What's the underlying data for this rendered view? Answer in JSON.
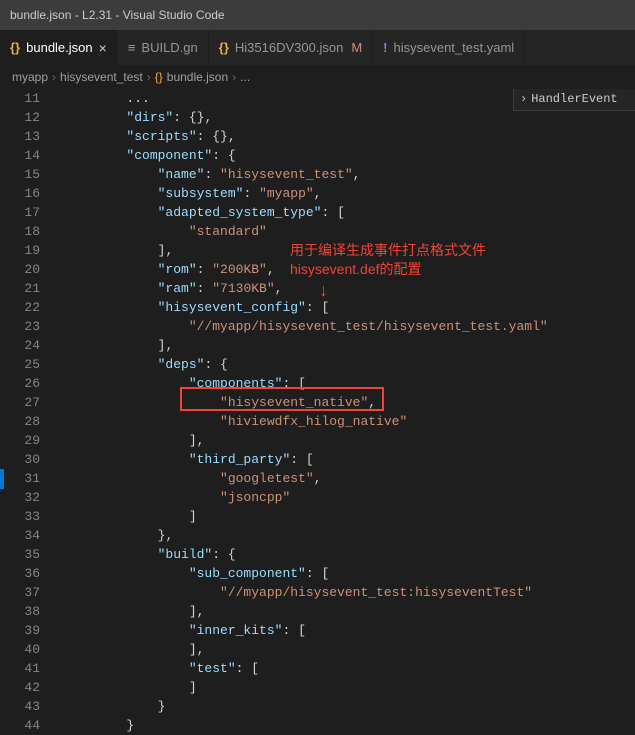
{
  "titlebar": {
    "text": "bundle.json - L2.31 - Visual Studio Code"
  },
  "tabs": [
    {
      "label": "bundle.json",
      "icon": "{}",
      "active": true,
      "close": "×"
    },
    {
      "label": "BUILD.gn",
      "icon": "≡",
      "active": false
    },
    {
      "label": "Hi3516DV300.json",
      "icon": "{}",
      "active": false,
      "modified": "M"
    },
    {
      "label": "hisysevent_test.yaml",
      "icon": "!",
      "active": false
    }
  ],
  "breadcrumb": {
    "parts": [
      "myapp",
      "hisysevent_test",
      "bundle.json",
      "..."
    ],
    "sep": "›"
  },
  "outline": {
    "chev": "›",
    "label": "HandlerEvent"
  },
  "annotation": {
    "line1": "用于编译生成事件打点格式文件",
    "line2": "hisysevent.def的配置",
    "arrow": "↓"
  },
  "code": [
    {
      "n": 11,
      "i": 2,
      "t": [
        [
          "p",
          "..."
        ]
      ]
    },
    {
      "n": 12,
      "i": 2,
      "t": [
        [
          "k",
          "\"dirs\""
        ],
        [
          "p",
          ": "
        ],
        [
          "p",
          "{}"
        ],
        [
          "p",
          ","
        ]
      ]
    },
    {
      "n": 13,
      "i": 2,
      "t": [
        [
          "k",
          "\"scripts\""
        ],
        [
          "p",
          ": "
        ],
        [
          "p",
          "{}"
        ],
        [
          "p",
          ","
        ]
      ]
    },
    {
      "n": 14,
      "i": 2,
      "t": [
        [
          "k",
          "\"component\""
        ],
        [
          "p",
          ": "
        ],
        [
          "p",
          "{"
        ]
      ]
    },
    {
      "n": 15,
      "i": 3,
      "t": [
        [
          "k",
          "\"name\""
        ],
        [
          "p",
          ": "
        ],
        [
          "s",
          "\"hisysevent_test\""
        ],
        [
          "p",
          ","
        ]
      ]
    },
    {
      "n": 16,
      "i": 3,
      "t": [
        [
          "k",
          "\"subsystem\""
        ],
        [
          "p",
          ": "
        ],
        [
          "s",
          "\"myapp\""
        ],
        [
          "p",
          ","
        ]
      ]
    },
    {
      "n": 17,
      "i": 3,
      "t": [
        [
          "k",
          "\"adapted_system_type\""
        ],
        [
          "p",
          ": "
        ],
        [
          "p",
          "["
        ]
      ]
    },
    {
      "n": 18,
      "i": 4,
      "t": [
        [
          "s",
          "\"standard\""
        ]
      ]
    },
    {
      "n": 19,
      "i": 3,
      "t": [
        [
          "p",
          "]"
        ],
        [
          "p",
          ","
        ]
      ]
    },
    {
      "n": 20,
      "i": 3,
      "t": [
        [
          "k",
          "\"rom\""
        ],
        [
          "p",
          ": "
        ],
        [
          "s",
          "\"200KB\""
        ],
        [
          "p",
          ","
        ]
      ]
    },
    {
      "n": 21,
      "i": 3,
      "t": [
        [
          "k",
          "\"ram\""
        ],
        [
          "p",
          ": "
        ],
        [
          "s",
          "\"7130KB\""
        ],
        [
          "p",
          ","
        ]
      ]
    },
    {
      "n": 22,
      "i": 3,
      "t": [
        [
          "k",
          "\"hisysevent_config\""
        ],
        [
          "p",
          ": "
        ],
        [
          "p",
          "["
        ]
      ]
    },
    {
      "n": 23,
      "i": 4,
      "t": [
        [
          "s",
          "\"//myapp/hisysevent_test/hisysevent_test.yaml\""
        ]
      ]
    },
    {
      "n": 24,
      "i": 3,
      "t": [
        [
          "p",
          "]"
        ],
        [
          "p",
          ","
        ]
      ]
    },
    {
      "n": 25,
      "i": 3,
      "t": [
        [
          "k",
          "\"deps\""
        ],
        [
          "p",
          ": "
        ],
        [
          "p",
          "{"
        ]
      ]
    },
    {
      "n": 26,
      "i": 4,
      "t": [
        [
          "k",
          "\"components\""
        ],
        [
          "p",
          ": "
        ],
        [
          "p",
          "["
        ]
      ]
    },
    {
      "n": 27,
      "i": 5,
      "t": [
        [
          "s",
          "\"hisysevent_native\""
        ],
        [
          "p",
          ","
        ]
      ]
    },
    {
      "n": 28,
      "i": 5,
      "t": [
        [
          "s",
          "\"hiviewdfx_hilog_native\""
        ]
      ]
    },
    {
      "n": 29,
      "i": 4,
      "t": [
        [
          "p",
          "]"
        ],
        [
          "p",
          ","
        ]
      ]
    },
    {
      "n": 30,
      "i": 4,
      "t": [
        [
          "k",
          "\"third_party\""
        ],
        [
          "p",
          ": "
        ],
        [
          "p",
          "["
        ]
      ]
    },
    {
      "n": 31,
      "i": 5,
      "t": [
        [
          "s",
          "\"googletest\""
        ],
        [
          "p",
          ","
        ]
      ]
    },
    {
      "n": 32,
      "i": 5,
      "t": [
        [
          "s",
          "\"jsoncpp\""
        ]
      ]
    },
    {
      "n": 33,
      "i": 4,
      "t": [
        [
          "p",
          "]"
        ]
      ]
    },
    {
      "n": 34,
      "i": 3,
      "t": [
        [
          "p",
          "}"
        ],
        [
          "p",
          ","
        ]
      ]
    },
    {
      "n": 35,
      "i": 3,
      "t": [
        [
          "k",
          "\"build\""
        ],
        [
          "p",
          ": "
        ],
        [
          "p",
          "{"
        ]
      ]
    },
    {
      "n": 36,
      "i": 4,
      "t": [
        [
          "k",
          "\"sub_component\""
        ],
        [
          "p",
          ": "
        ],
        [
          "p",
          "["
        ]
      ]
    },
    {
      "n": 37,
      "i": 5,
      "t": [
        [
          "s",
          "\"//myapp/hisysevent_test:hisyseventTest\""
        ]
      ]
    },
    {
      "n": 38,
      "i": 4,
      "t": [
        [
          "p",
          "]"
        ],
        [
          "p",
          ","
        ]
      ]
    },
    {
      "n": 39,
      "i": 4,
      "t": [
        [
          "k",
          "\"inner_kits\""
        ],
        [
          "p",
          ": "
        ],
        [
          "p",
          "["
        ]
      ]
    },
    {
      "n": 40,
      "i": 4,
      "t": [
        [
          "p",
          "]"
        ],
        [
          "p",
          ","
        ]
      ]
    },
    {
      "n": 41,
      "i": 4,
      "t": [
        [
          "k",
          "\"test\""
        ],
        [
          "p",
          ": "
        ],
        [
          "p",
          "["
        ]
      ]
    },
    {
      "n": 42,
      "i": 4,
      "t": [
        [
          "p",
          "]"
        ]
      ]
    },
    {
      "n": 43,
      "i": 3,
      "t": [
        [
          "p",
          "}"
        ]
      ]
    },
    {
      "n": 44,
      "i": 2,
      "t": [
        [
          "p",
          "}"
        ]
      ]
    }
  ]
}
